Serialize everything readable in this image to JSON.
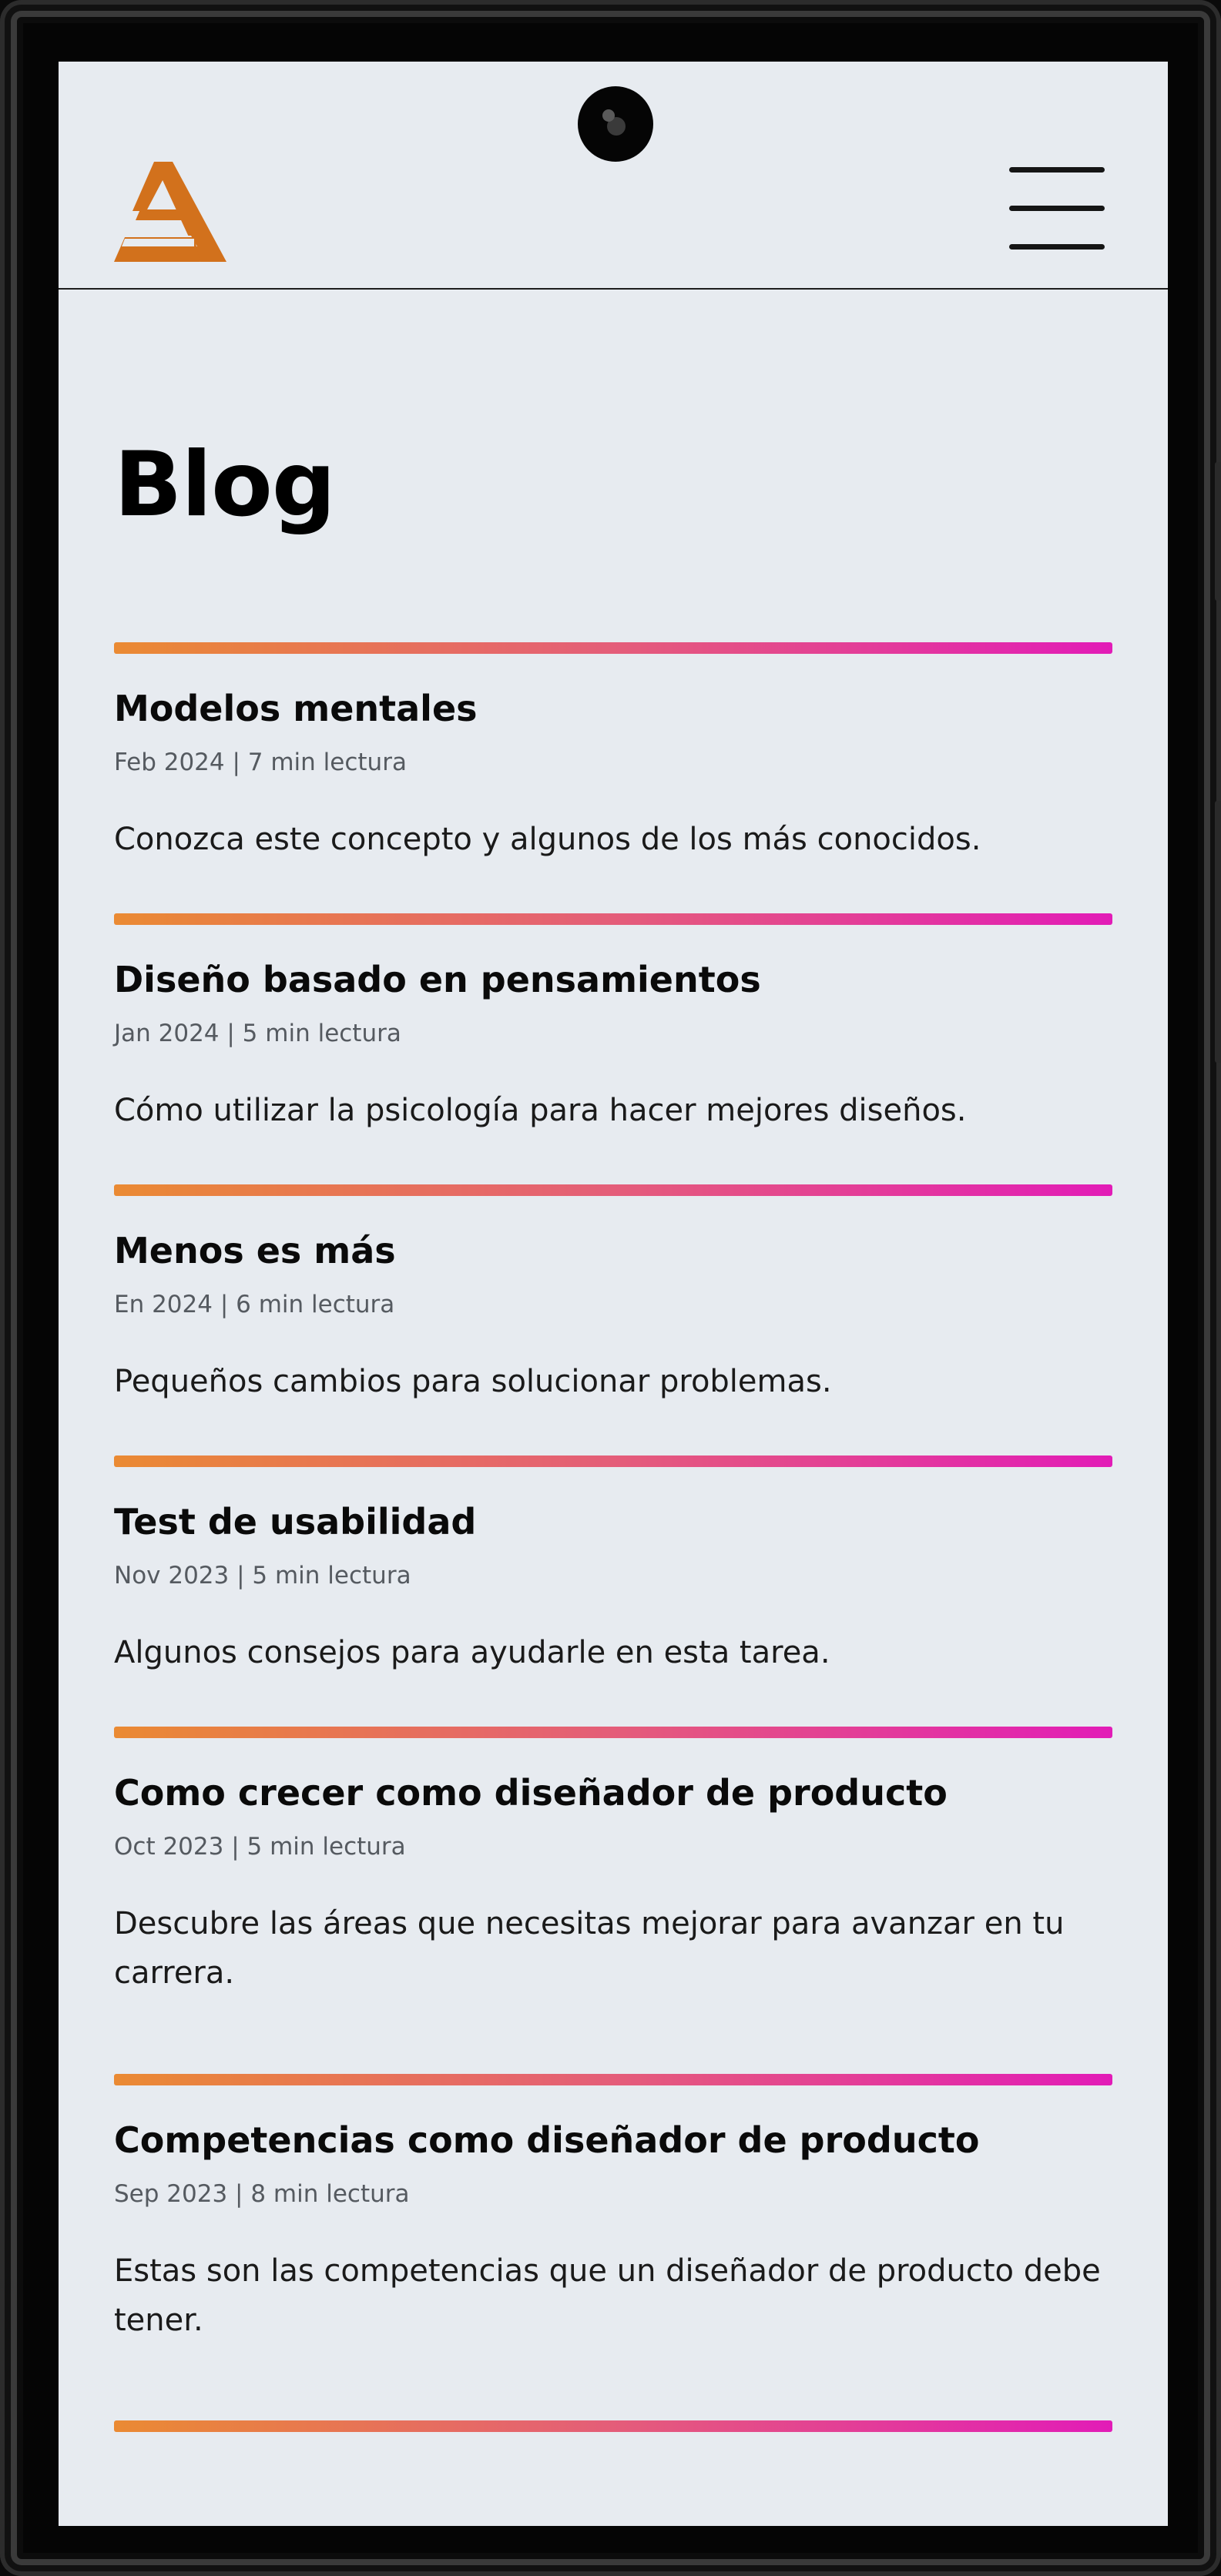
{
  "header": {
    "logo_label": "A",
    "menu_icon": "hamburger-menu-icon"
  },
  "page": {
    "title": "Blog"
  },
  "colors": {
    "accent_orange": "#ea8a33",
    "accent_pink": "#e21cb7",
    "logo": "#d2711c",
    "background": "#e7ebf0"
  },
  "posts": [
    {
      "title": "Modelos mentales",
      "meta": "Feb 2024 | 7 min lectura",
      "excerpt": "Conozca este concepto y algunos de los más conocidos."
    },
    {
      "title": "Diseño basado en pensamientos",
      "meta": "Jan 2024 | 5 min lectura",
      "excerpt": "Cómo utilizar la psicología para hacer mejores diseños."
    },
    {
      "title": "Menos es más",
      "meta": "En 2024 | 6 min lectura",
      "excerpt": "Pequeños cambios para solucionar problemas."
    },
    {
      "title": "Test de usabilidad",
      "meta": "Nov 2023 | 5 min lectura",
      "excerpt": "Algunos consejos para ayudarle en esta tarea."
    },
    {
      "title": "Como crecer como diseñador de producto",
      "meta": "Oct 2023 | 5 min lectura",
      "excerpt": "Descubre las áreas que necesitas mejorar para avanzar en tu carrera."
    },
    {
      "title": "Competencias como diseñador de producto",
      "meta": "Sep 2023 | 8 min lectura",
      "excerpt": "Estas son las competencias que un diseñador de producto debe tener."
    }
  ]
}
